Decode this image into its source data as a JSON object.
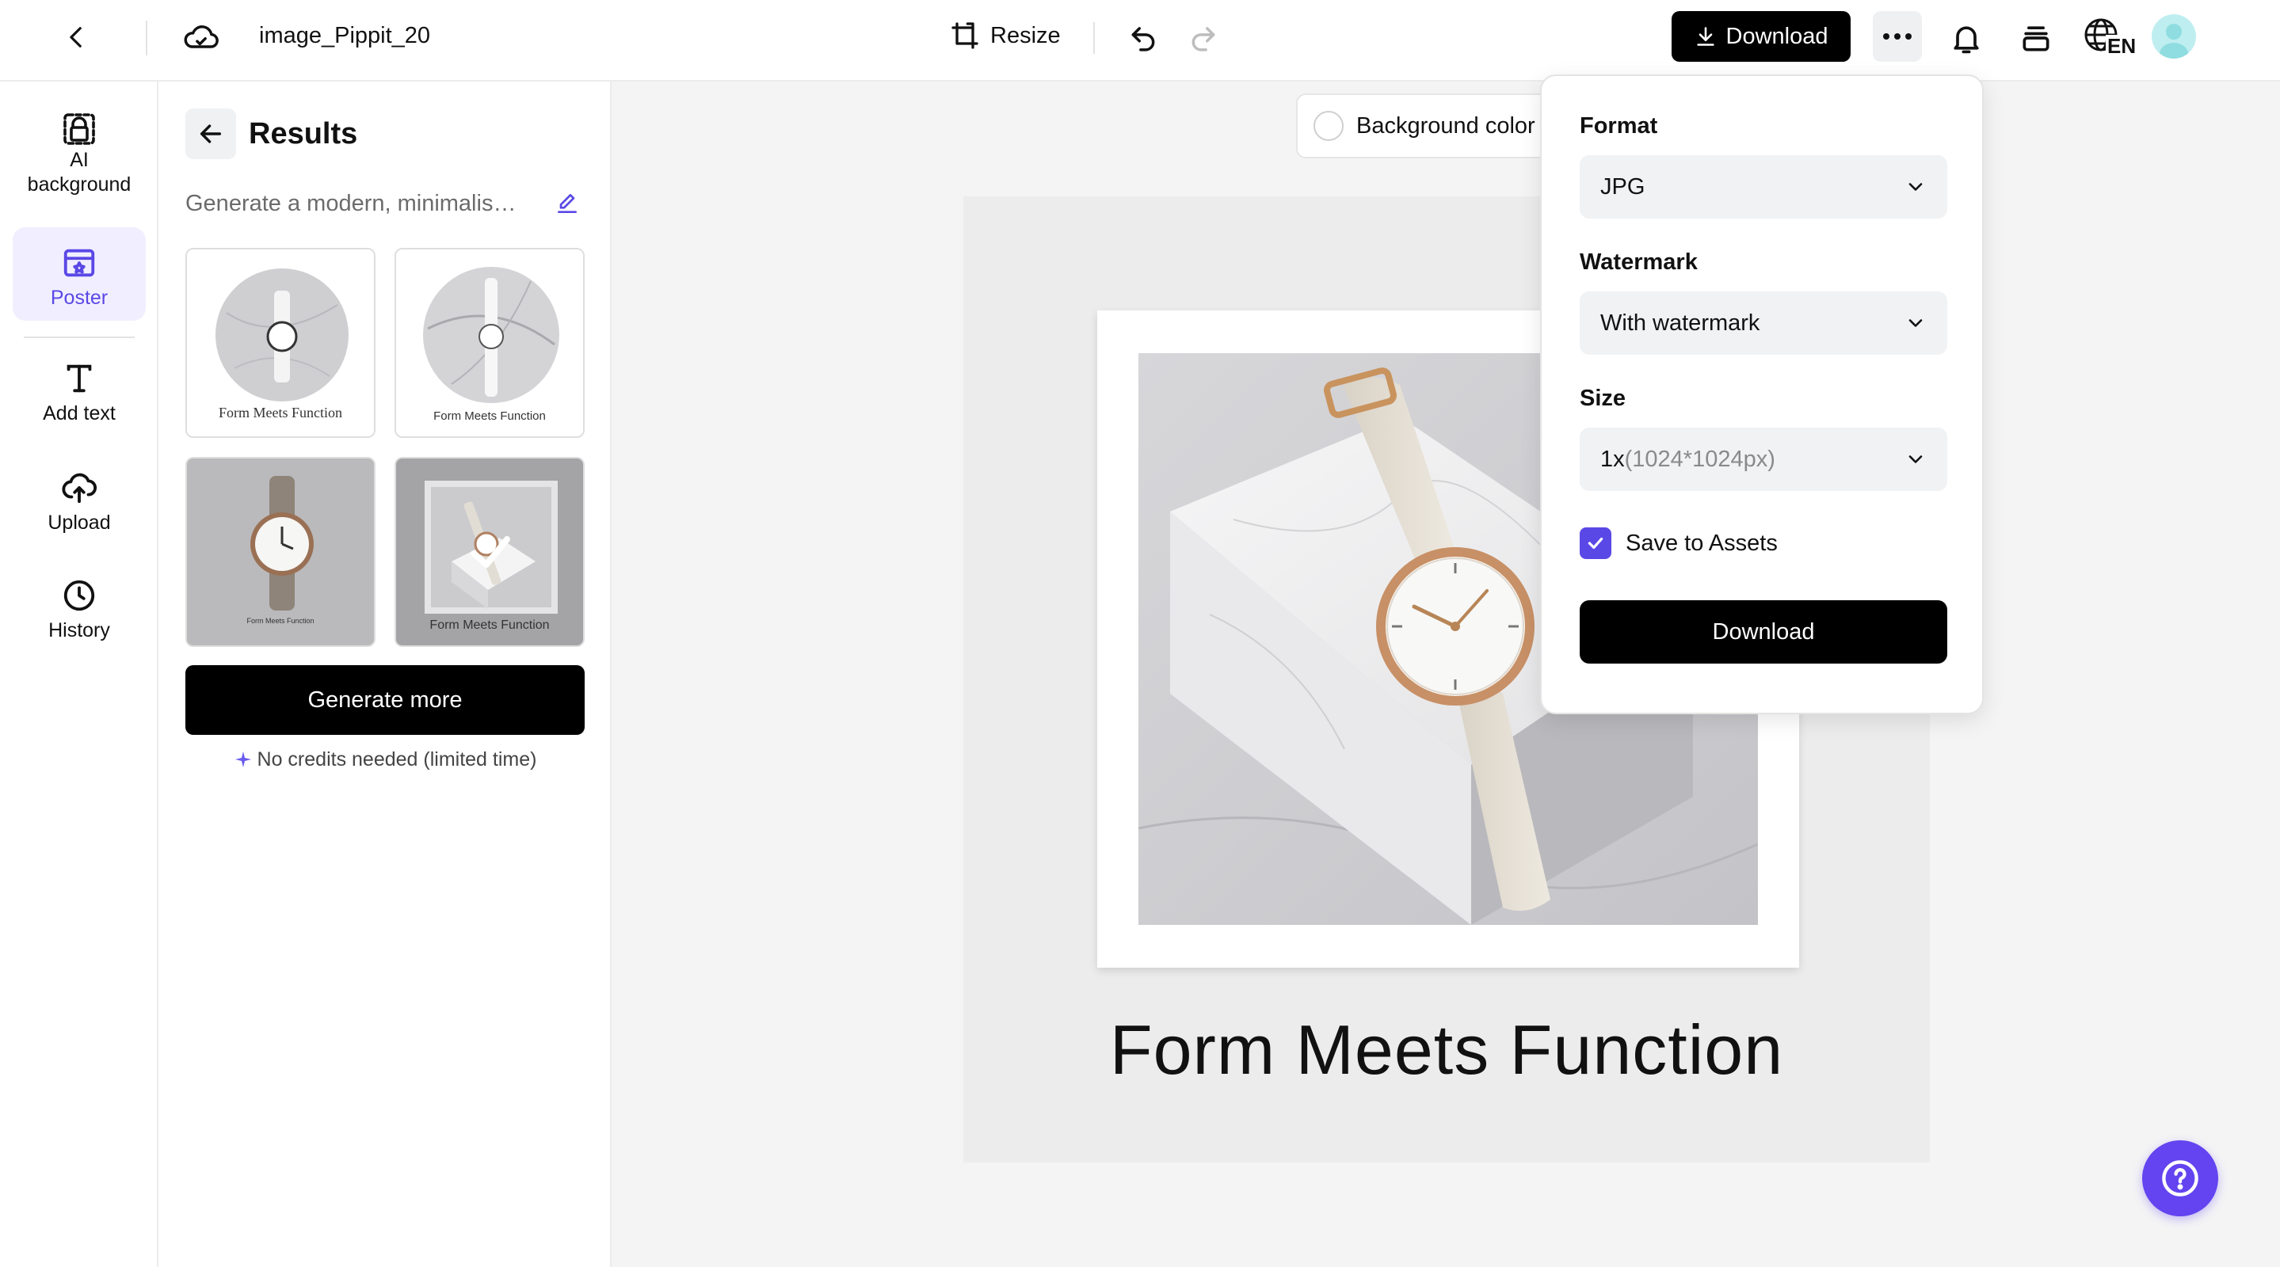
{
  "topbar": {
    "filename": "image_Pippit_20",
    "resize_label": "Resize",
    "download_label": "Download",
    "language_code": "EN"
  },
  "rail": {
    "items": [
      {
        "label": "AI background",
        "icon": "ai-background-icon"
      },
      {
        "label": "Poster",
        "icon": "poster-icon",
        "active": true
      },
      {
        "label": "Add text",
        "icon": "text-icon"
      },
      {
        "label": "Upload",
        "icon": "upload-icon"
      },
      {
        "label": "History",
        "icon": "history-icon"
      }
    ]
  },
  "panel": {
    "title": "Results",
    "prompt": "Generate a modern, minimalist ...",
    "thumbnails": [
      {
        "caption": "Form Meets Function"
      },
      {
        "caption": "Form Meets Function"
      },
      {
        "caption": "Form Meets Function"
      },
      {
        "caption": "Form Meets Function",
        "selected": true
      }
    ],
    "generate_more_label": "Generate more",
    "credits_note": "No credits needed (limited time)"
  },
  "canvas": {
    "background_color_label": "Background color",
    "poster_title": "Form Meets Function"
  },
  "download_popover": {
    "format_label": "Format",
    "format_value": "JPG",
    "watermark_label": "Watermark",
    "watermark_value": "With watermark",
    "size_label": "Size",
    "size_value": "1x",
    "size_detail": "(1024*1024px)",
    "save_to_assets_label": "Save to Assets",
    "save_to_assets_checked": true,
    "download_button_label": "Download"
  },
  "colors": {
    "accent": "#5a48e6",
    "help_fab": "#6344f0",
    "primary_button": "#000000"
  }
}
